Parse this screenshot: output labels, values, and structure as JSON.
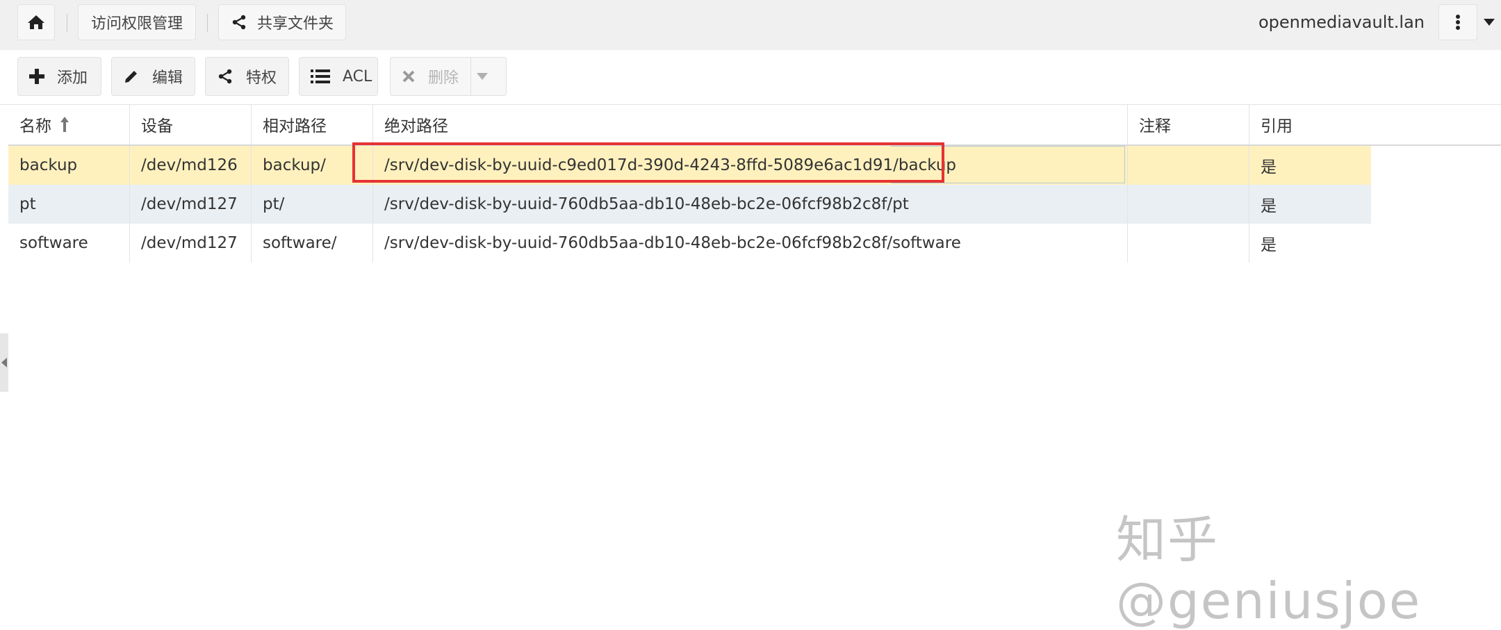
{
  "header": {
    "breadcrumb_access": "访问权限管理",
    "breadcrumb_shared": "共享文件夹",
    "hostname": "openmediavault.lan"
  },
  "toolbar": {
    "add_label": "添加",
    "edit_label": "编辑",
    "privileges_label": "特权",
    "acl_label": "ACL",
    "delete_label": "删除"
  },
  "grid": {
    "columns": [
      "名称",
      "设备",
      "相对路径",
      "绝对路径",
      "注释",
      "引用"
    ],
    "rows": [
      {
        "name": "backup",
        "device": "/dev/md126",
        "relpath": "backup/",
        "abspath": "/srv/dev-disk-by-uuid-c9ed017d-390d-4243-8ffd-5089e6ac1d91/backup",
        "comment": "",
        "referenced": "是"
      },
      {
        "name": "pt",
        "device": "/dev/md127",
        "relpath": "pt/",
        "abspath": "/srv/dev-disk-by-uuid-760db5aa-db10-48eb-bc2e-06fcf98b2c8f/pt",
        "comment": "",
        "referenced": "是"
      },
      {
        "name": "software",
        "device": "/dev/md127",
        "relpath": "software/",
        "abspath": "/srv/dev-disk-by-uuid-760db5aa-db10-48eb-bc2e-06fcf98b2c8f/software",
        "comment": "",
        "referenced": "是"
      }
    ]
  },
  "watermark": "知乎 @geniusjoe",
  "colors": {
    "selected_row": "#fff1be",
    "alt_row": "#eaeff3",
    "highlight_border": "#e53333"
  }
}
